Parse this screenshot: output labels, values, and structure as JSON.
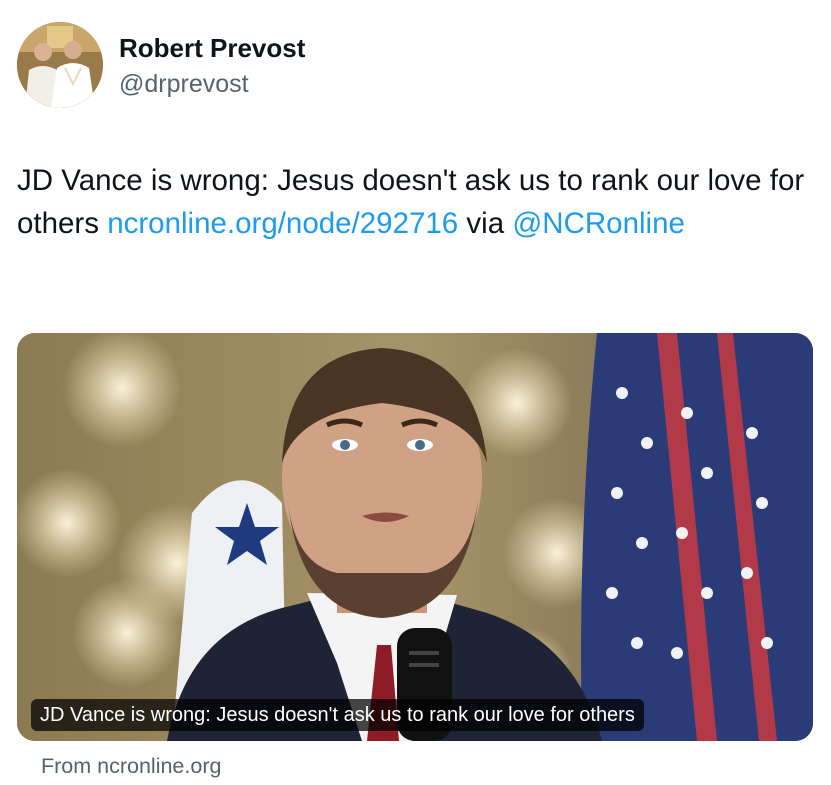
{
  "author": {
    "display_name": "Robert Prevost",
    "handle": "@drprevost",
    "avatar_icon": "profile-photo"
  },
  "tweet": {
    "text_before_link": "JD Vance is wrong: Jesus doesn't ask us to rank our love for others ",
    "link_text": "ncronline.org/node/292716",
    "text_middle": " via ",
    "mention": "@NCRonline"
  },
  "card": {
    "image_icon": "article-photo",
    "caption": "JD Vance is wrong: Jesus doesn't ask us to rank our love for others",
    "source": "From ncronline.org"
  },
  "colors": {
    "link": "#1d9bf0",
    "secondary_text": "#536471",
    "primary_text": "#0f1419",
    "background": "#ffffff"
  }
}
